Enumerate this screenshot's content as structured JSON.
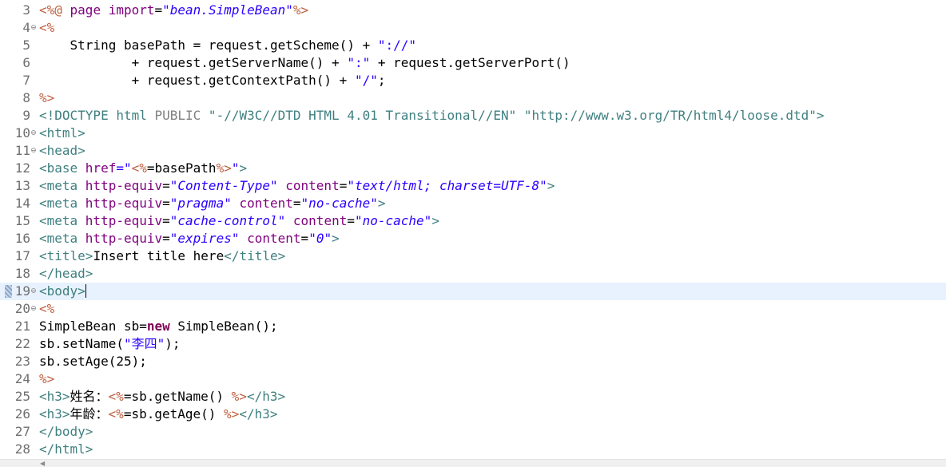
{
  "editor": {
    "caret_line": 19,
    "lines": [
      {
        "num": "3",
        "fold": false,
        "tokens": [
          {
            "t": "<%@",
            "c": "jd"
          },
          {
            "t": " page ",
            "c": "at"
          },
          {
            "t": "import",
            "c": "at"
          },
          {
            "t": "=",
            "c": ""
          },
          {
            "t": "\"bean.SimpleBean\"",
            "c": "si"
          },
          {
            "t": "%>",
            "c": "jd"
          }
        ]
      },
      {
        "num": "4",
        "fold": true,
        "tokens": [
          {
            "t": "<%",
            "c": "jd"
          }
        ]
      },
      {
        "num": "5",
        "fold": false,
        "tokens": [
          {
            "t": "    String basePath = request.getScheme() + ",
            "c": ""
          },
          {
            "t": "\"://\"",
            "c": "s"
          }
        ]
      },
      {
        "num": "6",
        "fold": false,
        "tokens": [
          {
            "t": "            + request.getServerName() + ",
            "c": ""
          },
          {
            "t": "\":\"",
            "c": "s"
          },
          {
            "t": " + request.getServerPort()",
            "c": ""
          }
        ]
      },
      {
        "num": "7",
        "fold": false,
        "tokens": [
          {
            "t": "            + request.getContextPath() + ",
            "c": ""
          },
          {
            "t": "\"/\"",
            "c": "s"
          },
          {
            "t": ";",
            "c": ""
          }
        ]
      },
      {
        "num": "8",
        "fold": false,
        "tokens": [
          {
            "t": "%>",
            "c": "jd"
          }
        ]
      },
      {
        "num": "9",
        "fold": false,
        "tokens": [
          {
            "t": "<!DOCTYPE",
            "c": "dt"
          },
          {
            "t": " html ",
            "c": "dt"
          },
          {
            "t": "PUBLIC",
            "c": "dk"
          },
          {
            "t": " \"-//W3C//DTD HTML 4.01 Transitional//EN\" \"http://www.w3.org/TR/html4/loose.dtd\"",
            "c": "dt"
          },
          {
            "t": ">",
            "c": "dt"
          }
        ]
      },
      {
        "num": "10",
        "fold": true,
        "tokens": [
          {
            "t": "<html>",
            "c": "tg"
          }
        ]
      },
      {
        "num": "11",
        "fold": true,
        "tokens": [
          {
            "t": "<head>",
            "c": "tg"
          }
        ]
      },
      {
        "num": "12",
        "fold": false,
        "tokens": [
          {
            "t": "<base ",
            "c": "tg"
          },
          {
            "t": "href",
            "c": "at"
          },
          {
            "t": "=\"",
            "c": "si"
          },
          {
            "t": "<%",
            "c": "jd"
          },
          {
            "t": "=basePath",
            "c": ""
          },
          {
            "t": "%>",
            "c": "jd"
          },
          {
            "t": "\"",
            "c": "si"
          },
          {
            "t": ">",
            "c": "tg"
          }
        ]
      },
      {
        "num": "13",
        "fold": false,
        "tokens": [
          {
            "t": "<meta ",
            "c": "tg"
          },
          {
            "t": "http-equiv",
            "c": "at"
          },
          {
            "t": "=",
            "c": ""
          },
          {
            "t": "\"Content-Type\"",
            "c": "si"
          },
          {
            "t": " ",
            "c": ""
          },
          {
            "t": "content",
            "c": "at"
          },
          {
            "t": "=",
            "c": ""
          },
          {
            "t": "\"text/html; charset=UTF-8\"",
            "c": "si"
          },
          {
            "t": ">",
            "c": "tg"
          }
        ]
      },
      {
        "num": "14",
        "fold": false,
        "tokens": [
          {
            "t": "<meta ",
            "c": "tg"
          },
          {
            "t": "http-equiv",
            "c": "at"
          },
          {
            "t": "=",
            "c": ""
          },
          {
            "t": "\"pragma\"",
            "c": "si"
          },
          {
            "t": " ",
            "c": ""
          },
          {
            "t": "content",
            "c": "at"
          },
          {
            "t": "=",
            "c": ""
          },
          {
            "t": "\"no-cache\"",
            "c": "si"
          },
          {
            "t": ">",
            "c": "tg"
          }
        ]
      },
      {
        "num": "15",
        "fold": false,
        "tokens": [
          {
            "t": "<meta ",
            "c": "tg"
          },
          {
            "t": "http-equiv",
            "c": "at"
          },
          {
            "t": "=",
            "c": ""
          },
          {
            "t": "\"cache-control\"",
            "c": "si"
          },
          {
            "t": " ",
            "c": ""
          },
          {
            "t": "content",
            "c": "at"
          },
          {
            "t": "=",
            "c": ""
          },
          {
            "t": "\"no-cache\"",
            "c": "si"
          },
          {
            "t": ">",
            "c": "tg"
          }
        ]
      },
      {
        "num": "16",
        "fold": false,
        "tokens": [
          {
            "t": "<meta ",
            "c": "tg"
          },
          {
            "t": "http-equiv",
            "c": "at"
          },
          {
            "t": "=",
            "c": ""
          },
          {
            "t": "\"expires\"",
            "c": "si"
          },
          {
            "t": " ",
            "c": ""
          },
          {
            "t": "content",
            "c": "at"
          },
          {
            "t": "=",
            "c": ""
          },
          {
            "t": "\"0\"",
            "c": "si"
          },
          {
            "t": ">",
            "c": "tg"
          }
        ]
      },
      {
        "num": "17",
        "fold": false,
        "tokens": [
          {
            "t": "<title>",
            "c": "tg"
          },
          {
            "t": "Insert title here",
            "c": ""
          },
          {
            "t": "</title>",
            "c": "tg"
          }
        ]
      },
      {
        "num": "18",
        "fold": false,
        "tokens": [
          {
            "t": "</head>",
            "c": "tg"
          }
        ]
      },
      {
        "num": "19",
        "fold": true,
        "tokens": [
          {
            "t": "<body>",
            "c": "tg"
          }
        ]
      },
      {
        "num": "20",
        "fold": true,
        "tokens": [
          {
            "t": "<%",
            "c": "jd"
          }
        ]
      },
      {
        "num": "21",
        "fold": false,
        "tokens": [
          {
            "t": "SimpleBean sb=",
            "c": ""
          },
          {
            "t": "new",
            "c": "k"
          },
          {
            "t": " SimpleBean();",
            "c": ""
          }
        ]
      },
      {
        "num": "22",
        "fold": false,
        "tokens": [
          {
            "t": "sb.setName(",
            "c": ""
          },
          {
            "t": "\"李四\"",
            "c": "s"
          },
          {
            "t": ");",
            "c": ""
          }
        ]
      },
      {
        "num": "23",
        "fold": false,
        "tokens": [
          {
            "t": "sb.setAge(25);",
            "c": ""
          }
        ]
      },
      {
        "num": "24",
        "fold": false,
        "tokens": [
          {
            "t": "%>",
            "c": "jd"
          }
        ]
      },
      {
        "num": "25",
        "fold": false,
        "tokens": [
          {
            "t": "<h3>",
            "c": "tg"
          },
          {
            "t": "姓名：",
            "c": ""
          },
          {
            "t": "<%",
            "c": "jd"
          },
          {
            "t": "=sb.getName() ",
            "c": ""
          },
          {
            "t": "%>",
            "c": "jd"
          },
          {
            "t": "</h3>",
            "c": "tg"
          }
        ]
      },
      {
        "num": "26",
        "fold": false,
        "tokens": [
          {
            "t": "<h3>",
            "c": "tg"
          },
          {
            "t": "年龄：",
            "c": ""
          },
          {
            "t": "<%",
            "c": "jd"
          },
          {
            "t": "=sb.getAge() ",
            "c": ""
          },
          {
            "t": "%>",
            "c": "jd"
          },
          {
            "t": "</h3>",
            "c": "tg"
          }
        ]
      },
      {
        "num": "27",
        "fold": false,
        "tokens": [
          {
            "t": "</body>",
            "c": "tg"
          }
        ]
      },
      {
        "num": "28",
        "fold": false,
        "tokens": [
          {
            "t": "</html>",
            "c": "tg"
          }
        ]
      }
    ]
  },
  "scrollbar": {
    "arrow_icon": "chevron-left-icon"
  }
}
